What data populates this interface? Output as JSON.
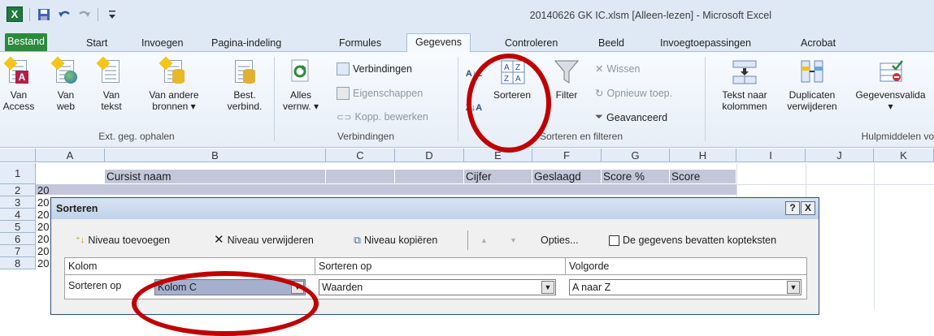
{
  "window": {
    "title": "20140626 GK IC.xlsm  [Alleen-lezen]  -  Microsoft Excel",
    "logo": "X"
  },
  "tabs": [
    "Bestand",
    "Start",
    "Invoegen",
    "Pagina-indeling",
    "Formules",
    "Gegevens",
    "Controleren",
    "Beeld",
    "Invoegtoepassingen",
    "Acrobat"
  ],
  "active_tab": "Gegevens",
  "ribbon": {
    "ext": {
      "access": [
        "Van",
        "Access"
      ],
      "web": [
        "Van",
        "web"
      ],
      "text": [
        "Van",
        "tekst"
      ],
      "other": [
        "Van andere",
        "bronnen ▾"
      ],
      "existing": [
        "Best.",
        "verbind."
      ],
      "label": "Ext. geg. ophalen"
    },
    "connections": {
      "refresh": [
        "Alles",
        "vernw. ▾"
      ],
      "items": [
        "Verbindingen",
        "Eigenschappen",
        "Kopp. bewerken"
      ],
      "label": "Verbindingen"
    },
    "sort": {
      "az": "A Z",
      "za": "Z A",
      "sort": "Sorteren",
      "filter": "Filter",
      "items": [
        "Wissen",
        "Opnieuw toep.",
        "Geavanceerd"
      ],
      "label": "Sorteren en filteren"
    },
    "tools": {
      "text_to_cols": [
        "Tekst naar",
        "kolommen"
      ],
      "dups": [
        "Duplicaten",
        "verwijderen"
      ],
      "validation": [
        "Gegevensvalida",
        "▾"
      ],
      "label": "Hulpmiddelen vo"
    }
  },
  "sheet": {
    "columns": [
      "A",
      "B",
      "C",
      "D",
      "E",
      "F",
      "G",
      "H",
      "I",
      "J",
      "K"
    ],
    "rows": [
      "1",
      "2",
      "3",
      "4",
      "5",
      "6",
      "7",
      "8"
    ],
    "row1": [
      "Cursist naam",
      "Cijfer",
      "Geslaagd",
      "Score %",
      "Score"
    ],
    "colA_values": [
      "20",
      "20",
      "20",
      "20",
      "20",
      "20",
      "20"
    ]
  },
  "dialog": {
    "title": "Sorteren",
    "help": "?",
    "close": "X",
    "toolbar": {
      "add": "Niveau toevoegen",
      "delete": "Niveau verwijderen",
      "copy": "Niveau kopiëren",
      "up": "▲",
      "down": "▼",
      "options": "Opties...",
      "headers": "De gegevens bevatten kopteksten"
    },
    "grid_headers": [
      "Kolom",
      "Sorteren op",
      "Volgorde"
    ],
    "row": {
      "label": "Sorteren op",
      "column": "Kolom C",
      "sort_on": "Waarden",
      "order": "A naar Z"
    }
  },
  "colors": {
    "annotation": "#c00000",
    "file_tab": "#2a8a3e",
    "dialog_title": "#c1d2ea",
    "selected_combo": "#a5b0cf"
  }
}
